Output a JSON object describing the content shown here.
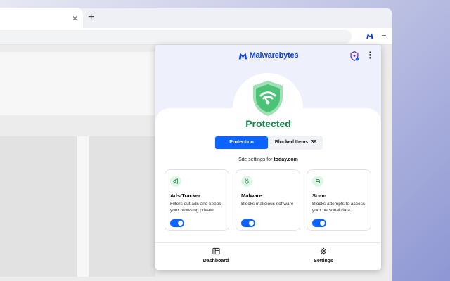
{
  "browser": {
    "tab_close": "×",
    "new_tab": "+",
    "menu_glyph": "≡"
  },
  "popup": {
    "brand": "Malwarebytes",
    "more_glyph": "⋮",
    "status": "Protected",
    "tabs": [
      {
        "label": "Protection",
        "active": true
      },
      {
        "label": "Blocked Items: 39",
        "active": false
      }
    ],
    "site_settings": {
      "prefix": "Site settings for ",
      "domain": "today.com"
    },
    "cards": [
      {
        "icon": "megaphone-icon",
        "title": "Ads/Tracker",
        "description": "Filters out ads and keeps your browsing private",
        "enabled": true
      },
      {
        "icon": "bug-icon",
        "title": "Malware",
        "description": "Blocks malicious software",
        "enabled": true
      },
      {
        "icon": "robber-icon",
        "title": "Scam",
        "description": "Blocks attempts to access your personal data",
        "enabled": true
      }
    ],
    "footer": [
      {
        "icon": "dashboard-icon",
        "label": "Dashboard"
      },
      {
        "icon": "settings-gear-icon",
        "label": "Settings"
      }
    ]
  },
  "colors": {
    "accent": "#0d63ff",
    "brand": "#0d3fd6",
    "protected_green": "#16874a"
  }
}
